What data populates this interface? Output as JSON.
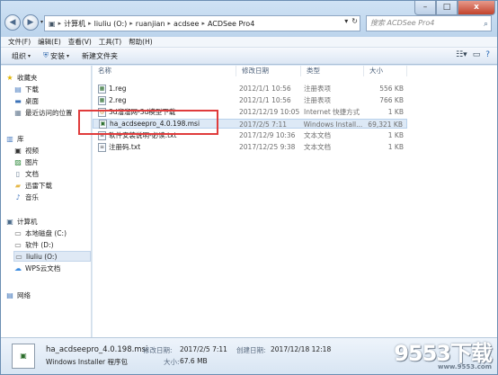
{
  "window": {
    "controls": {
      "minimize": "–",
      "maximize": "□",
      "close": "x"
    }
  },
  "address": {
    "back_glyph": "◀",
    "forward_glyph": "▶",
    "crumbs": [
      "计算机",
      "liuliu (O:)",
      "ruanjian",
      "acdsee",
      "ACDSee Pro4"
    ],
    "separator": "▸",
    "refresh_glyph": "↻"
  },
  "search": {
    "placeholder": "搜索 ACDSee Pro4"
  },
  "menu": [
    "文件(F)",
    "编辑(E)",
    "查看(V)",
    "工具(T)",
    "帮助(H)"
  ],
  "toolbar": {
    "organize": "组织",
    "install": "安装",
    "new_folder": "新建文件夹"
  },
  "sidebar": {
    "favorites": {
      "title": "收藏夹",
      "items": [
        "下载",
        "桌面",
        "最近访问的位置"
      ]
    },
    "library": {
      "title": "库",
      "items": [
        "视频",
        "图片",
        "文档",
        "迅雷下载",
        "音乐"
      ]
    },
    "computer": {
      "title": "计算机",
      "items": [
        "本地磁盘 (C:)",
        "软件 (D:)",
        "liuliu (O:)",
        "WPS云文档"
      ]
    },
    "network": {
      "title": "网络"
    }
  },
  "columns": {
    "name": "名称",
    "date": "修改日期",
    "type": "类型",
    "size": "大小"
  },
  "files": [
    {
      "name": "1.reg",
      "date": "2012/1/1 10:56",
      "type": "注册表项",
      "size": "556 KB"
    },
    {
      "name": "2.reg",
      "date": "2012/1/1 10:56",
      "type": "注册表项",
      "size": "766 KB"
    },
    {
      "name": "3d溜溜网-3d模型下载",
      "date": "2012/12/19 10:05",
      "type": "Internet 快捷方式",
      "size": "1 KB"
    },
    {
      "name": "ha_acdseepro_4.0.198.msi",
      "date": "2017/2/5 7:11",
      "type": "Windows Install...",
      "size": "69,321 KB"
    },
    {
      "name": "软件安装说明-必读.txt",
      "date": "2017/12/9 10:36",
      "type": "文本文档",
      "size": "1 KB"
    },
    {
      "name": "注册码.txt",
      "date": "2017/12/25 9:38",
      "type": "文本文档",
      "size": "1 KB"
    }
  ],
  "details": {
    "filename": "ha_acdseepro_4.0.198.msi",
    "modified_label": "修改日期:",
    "modified": "2017/2/5 7:11",
    "created_label": "创建日期:",
    "created": "2017/12/18 12:18",
    "filetype": "Windows Installer 程序包",
    "size_label": "大小:",
    "size": "67.6 MB"
  },
  "watermark": {
    "brand": "9553下载",
    "sub": "www.9553.com"
  }
}
